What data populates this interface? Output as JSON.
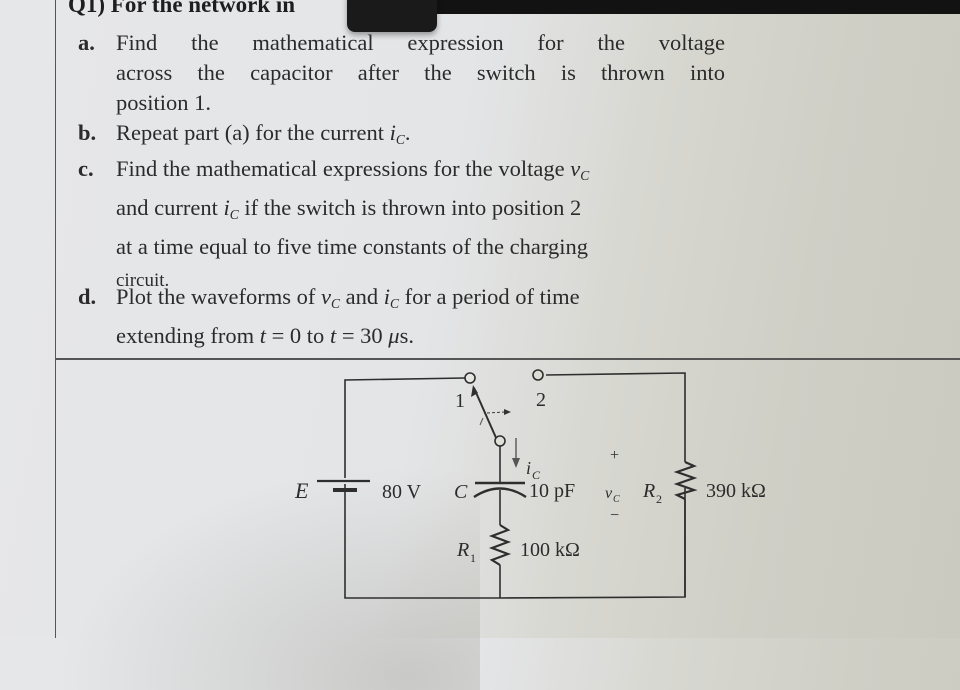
{
  "heading": "Q1) For the network in",
  "items": [
    {
      "label": "a.",
      "lines": [
        "Find the mathematical expression for the voltage",
        "across the capacitor after the switch is thrown into",
        "position 1."
      ]
    },
    {
      "label": "b.",
      "line_pre": "Repeat part (a) for the current ",
      "var": "i",
      "var_sub": "C",
      "line_post": "."
    },
    {
      "label": "c.",
      "line1_pre": "Find the mathematical expressions for the voltage ",
      "line1_var": "v",
      "line1_sub": "C",
      "line2_pre": "and current ",
      "line2_var": "i",
      "line2_sub": "C",
      "line2_post": " if the switch is thrown into position 2",
      "line3": "at a time equal to five time constants of the charging",
      "line4": "circuit."
    },
    {
      "label": "d.",
      "line1_pre": "Plot the waveforms of ",
      "line1_var1": "v",
      "line1_sub1": "C",
      "line1_mid": " and ",
      "line1_var2": "i",
      "line1_sub2": "C",
      "line1_post": " for a period of time",
      "line2_pre": "extending from ",
      "line2_t1": "t",
      "line2_eq1": " = 0 to ",
      "line2_t2": "t",
      "line2_eq2": " = 30 ",
      "line2_unit_mu": "μ",
      "line2_unit_s": "s."
    }
  ],
  "circuit": {
    "source": {
      "name": "E",
      "value": "80 V"
    },
    "switch": {
      "pos1": "1",
      "pos2": "2"
    },
    "capacitor": {
      "name": "C",
      "value": "10 pF",
      "current_label": "i",
      "current_sub": "C"
    },
    "r1": {
      "name": "R",
      "sub": "1",
      "value": "100 kΩ"
    },
    "r2": {
      "name": "R",
      "sub": "2",
      "value": "390 kΩ"
    },
    "vc": {
      "name": "v",
      "sub": "C",
      "plus": "+",
      "minus": "−"
    }
  }
}
